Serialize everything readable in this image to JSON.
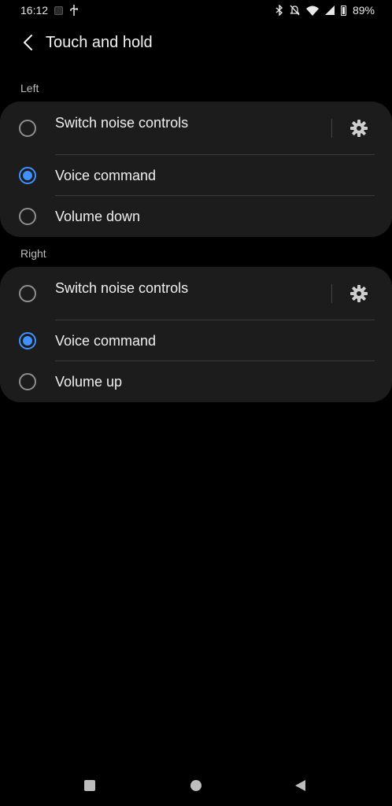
{
  "status": {
    "time": "16:12",
    "battery": "89%"
  },
  "header": {
    "title": "Touch and hold"
  },
  "sections": [
    {
      "label": "Left",
      "options": [
        {
          "label": "Switch noise controls",
          "checked": false,
          "has_settings": true
        },
        {
          "label": "Voice command",
          "checked": true
        },
        {
          "label": "Volume down",
          "checked": false
        }
      ]
    },
    {
      "label": "Right",
      "options": [
        {
          "label": "Switch noise controls",
          "checked": false,
          "has_settings": true
        },
        {
          "label": "Voice command",
          "checked": true
        },
        {
          "label": "Volume up",
          "checked": false
        }
      ]
    }
  ],
  "colors": {
    "accent": "#3e91ff",
    "card": "#1c1c1c",
    "background": "#000000"
  },
  "icons": {
    "back": "chevron-left-icon",
    "settings": "gear-icon",
    "nav": [
      "recents-icon",
      "home-icon",
      "back-icon"
    ]
  }
}
